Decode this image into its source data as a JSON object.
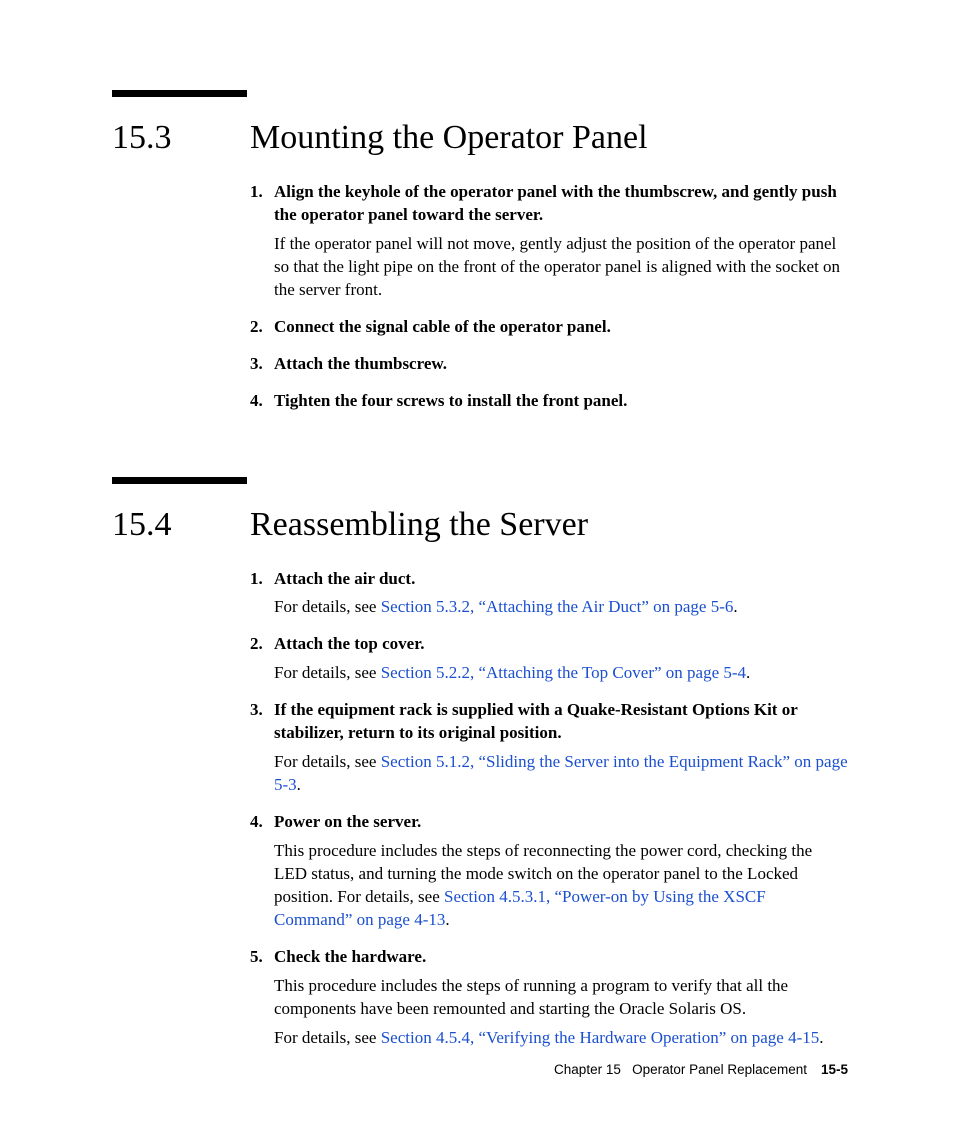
{
  "sections": [
    {
      "number": "15.3",
      "title": "Mounting the Operator Panel",
      "steps": [
        {
          "n": "1.",
          "title": "Align the keyhole of the operator panel with the thumbscrew, and gently push the operator panel toward the server.",
          "para": "If the operator panel will not move, gently adjust the position of the operator panel so that the light pipe on the front of the operator panel is aligned with the socket on the server front."
        },
        {
          "n": "2.",
          "title": "Connect the signal cable of the operator panel."
        },
        {
          "n": "3.",
          "title": "Attach the thumbscrew."
        },
        {
          "n": "4.",
          "title": "Tighten the four screws to install the front panel."
        }
      ]
    },
    {
      "number": "15.4",
      "title": "Reassembling the Server",
      "steps": [
        {
          "n": "1.",
          "title": "Attach the air duct.",
          "para_pre": "For details, see ",
          "link": "Section 5.3.2, “Attaching the Air Duct” on page 5-6",
          "para_post": "."
        },
        {
          "n": "2.",
          "title": "Attach the top cover.",
          "para_pre": "For details, see ",
          "link": "Section 5.2.2, “Attaching the Top Cover” on page 5-4",
          "para_post": "."
        },
        {
          "n": "3.",
          "title": "If the equipment rack is supplied with a Quake-Resistant Options Kit or stabilizer, return to its original position.",
          "para_pre": "For details, see ",
          "link": "Section 5.1.2, “Sliding the Server into the Equipment Rack” on page 5-3",
          "para_post": "."
        },
        {
          "n": "4.",
          "title": "Power on the server.",
          "para_pre": "This procedure includes the steps of reconnecting the power cord, checking the LED status, and turning the mode switch on the operator panel to the Locked position. For details, see ",
          "link": "Section 4.5.3.1, “Power-on by Using the XSCF Command” on page 4-13",
          "para_post": "."
        },
        {
          "n": "5.",
          "title": "Check the hardware.",
          "para": "This procedure includes the steps of running a program to verify that all the components have been remounted and starting the Oracle Solaris OS.",
          "para2_pre": "For details, see ",
          "link": "Section 4.5.4, “Verifying the Hardware Operation” on page 4-15",
          "para2_post": "."
        }
      ]
    }
  ],
  "footer": {
    "chapter": "Chapter 15",
    "chapter_title": "Operator Panel Replacement",
    "page": "15-5"
  }
}
